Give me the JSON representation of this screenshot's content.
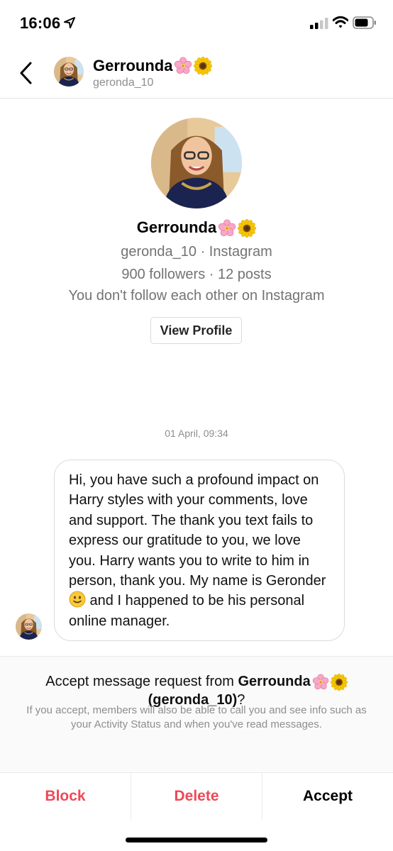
{
  "status_bar": {
    "time": "16:06"
  },
  "header": {
    "name": "Gerrounda",
    "handle": "geronda_10"
  },
  "profile": {
    "name": "Gerrounda",
    "handle_line": "geronda_10 · Instagram",
    "stats_line": "900 followers · 12 posts",
    "follow_line": "You don't follow each other on Instagram",
    "view_profile_label": "View Profile"
  },
  "conversation": {
    "timestamp": "01 April, 09:34",
    "message": {
      "before_emoji": "Hi, you have such a profound impact on Harry styles with your comments, love and support. The thank you text fails to express our gratitude to you, we love you. Harry wants you to write to him in person, thank you. My name is Geronder",
      "after_emoji": " and I happened to be his personal online manager."
    }
  },
  "request": {
    "title_prefix": "Accept message request from ",
    "title_name": "Gerrounda",
    "title_handle": "(geronda_10)",
    "title_suffix": "?",
    "note": "If you accept, members will also be able to call you and see info such as your Activity Status and when you've read messages."
  },
  "actions": {
    "block": "Block",
    "delete": "Delete",
    "accept": "Accept"
  },
  "colors": {
    "danger": "#ed4956",
    "muted": "#8e8e8e",
    "border": "#dbdbdb"
  },
  "icons": [
    "location-arrow-icon",
    "signal-icon",
    "wifi-icon",
    "battery-icon",
    "back-chevron-icon",
    "cherry-blossom-icon",
    "sunflower-icon",
    "slightly-smiling-face-icon"
  ]
}
